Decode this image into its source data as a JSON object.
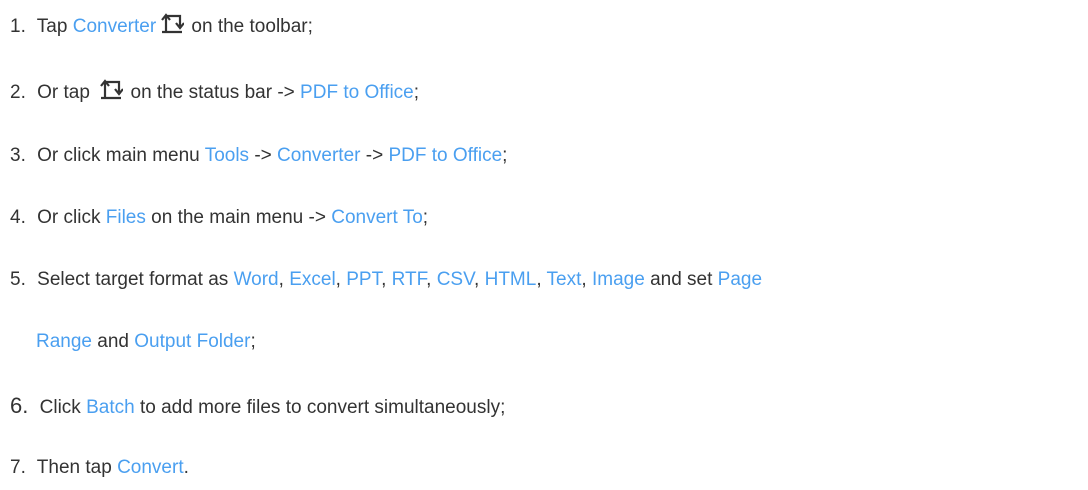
{
  "colors": {
    "text": "#333333",
    "accent": "#4a9ff0"
  },
  "icons": {
    "converter": "converter-icon"
  },
  "steps": [
    {
      "num": "1.",
      "a": "Tap",
      "converter": "Converter",
      "b": "on the toolbar;"
    },
    {
      "num": "2.",
      "a": "Or tap",
      "b": "on the status bar ->",
      "pdf_office": "PDF to Office",
      "end": ";"
    },
    {
      "num": "3.",
      "a": "Or click main menu",
      "tools": "Tools",
      "arrow1": "->",
      "converter": "Converter",
      "arrow2": "->",
      "pdf_office": "PDF to Office",
      "end": ";"
    },
    {
      "num": "4.",
      "a": "Or click",
      "files": "Files",
      "b": "on the main menu ->",
      "convert_to": "Convert To",
      "end": ";"
    },
    {
      "num": "5.",
      "a": "Select target format as",
      "word": "Word",
      "excel": "Excel",
      "ppt": "PPT",
      "rtf": "RTF",
      "csv": "CSV",
      "html": "HTML",
      "text": "Text",
      "image": "Image",
      "comma": ",",
      "b": "and set",
      "page": "Page",
      "range": "Range",
      "and": "and",
      "output_folder": "Output Folder",
      "end": ";"
    },
    {
      "num": "6.",
      "a": "Click",
      "batch": "Batch",
      "b": "to add more files to convert simultaneously;"
    },
    {
      "num": "7.",
      "a": "Then tap",
      "convert": "Convert",
      "end": "."
    }
  ]
}
